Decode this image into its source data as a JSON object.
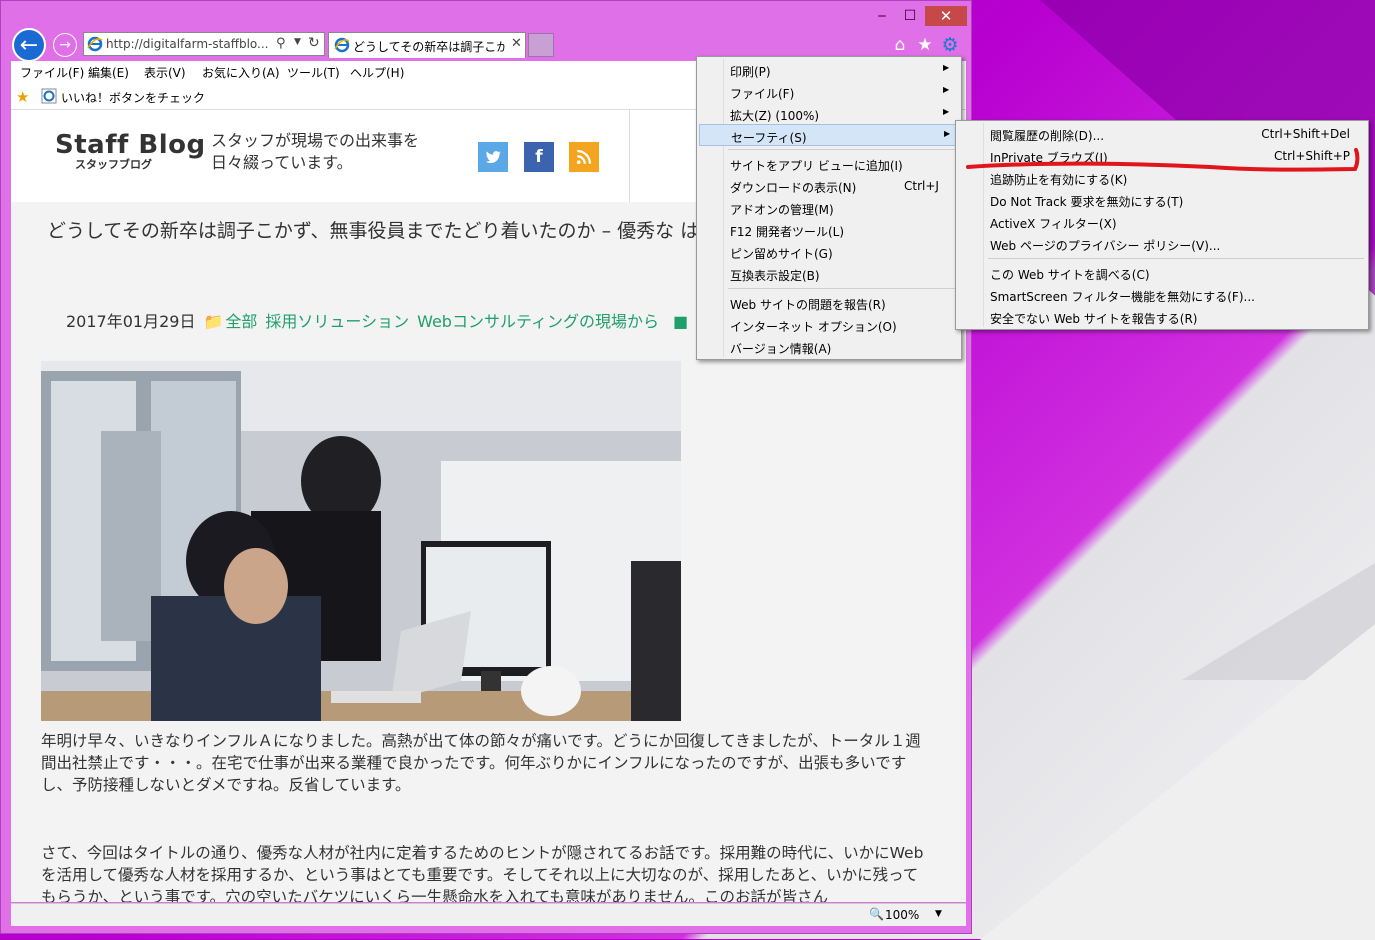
{
  "browser": {
    "address_url": "http://digitalfarm-staffblo...",
    "tab_title": "どうしてその新卒は調子こかず...",
    "window_buttons": {
      "minimize": "‒",
      "maximize": "☐",
      "close": "✕"
    }
  },
  "menubar": [
    "ファイル(F)",
    "編集(E)",
    "表示(V)",
    "お気に入り(A)",
    "ツール(T)",
    "ヘルプ(H)"
  ],
  "favorites_bar": {
    "link": "いいね！ボタンをチェック"
  },
  "site": {
    "logo": "Staff Blog",
    "logo_sub": "スタッフブログ",
    "tagline_line1": "スタッフが現場での出来事を",
    "tagline_line2": "日々綴っています。",
    "social": [
      "twitter",
      "facebook",
      "rss"
    ]
  },
  "post": {
    "title": "どうしてその新卒は調子こかず、無事役員までたどり着いたのか – 優秀な は",
    "date": "2017年01月29日",
    "categories": [
      "全部",
      "採用ソリューション",
      "Webコンサルティングの現場から"
    ],
    "para1": "年明け早々、いきなりインフルＡになりました。高熱が出て体の節々が痛いです。どうにか回復してきましたが、トータル１週間出社禁止です・・・。在宅で仕事が出来る業種で良かったです。何年ぶりかにインフルになったのですが、出張も多いですし、予防接種しないとダメですね。反省しています。",
    "para2": "さて、今回はタイトルの通り、優秀な人材が社内に定着するためのヒントが隠されてるお話です。採用難の時代に、いかにWebを活用して優秀な人材を採用するか、という事はとても重要です。そしてそれ以上に大切なのが、採用したあと、いかに残ってもらうか、という事です。穴の空いたバケツにいくら一生懸命水を入れても意味がありません。このお話が皆さん"
  },
  "status": {
    "zoom": "100%"
  },
  "tools_menu": [
    {
      "label": "印刷(P)",
      "submenu": true
    },
    {
      "label": "ファイル(F)",
      "submenu": true
    },
    {
      "label": "拡大(Z) (100%)",
      "submenu": true
    },
    {
      "label": "セーフティ(S)",
      "submenu": true,
      "highlighted": true
    },
    {
      "label": "サイトをアプリ ビューに追加(I)"
    },
    {
      "label": "ダウンロードの表示(N)",
      "shortcut": "Ctrl+J"
    },
    {
      "label": "アドオンの管理(M)"
    },
    {
      "label": "F12 開発者ツール(L)"
    },
    {
      "label": "ピン留めサイト(G)"
    },
    {
      "label": "互換表示設定(B)"
    },
    {
      "label": "Web サイトの問題を報告(R)"
    },
    {
      "label": "インターネット オプション(O)"
    },
    {
      "label": "バージョン情報(A)"
    }
  ],
  "safety_menu": [
    {
      "label": "閲覧履歴の削除(D)...",
      "shortcut": "Ctrl+Shift+Del"
    },
    {
      "label": "InPrivate ブラウズ(I)",
      "shortcut": "Ctrl+Shift+P",
      "annotated": true
    },
    {
      "label": "追跡防止を有効にする(K)"
    },
    {
      "label": "Do Not Track 要求を無効にする(T)"
    },
    {
      "label": "ActiveX フィルター(X)"
    },
    {
      "label": "Web ページのプライバシー ポリシー(V)..."
    },
    {
      "label": "この Web サイトを調べる(C)"
    },
    {
      "label": "SmartScreen フィルター機能を無効にする(F)..."
    },
    {
      "label": "安全でない Web サイトを報告する(R)"
    }
  ],
  "colors": {
    "annotation": "#e0161c",
    "category": "#1fa06b",
    "accent": "#1b6ad3"
  }
}
